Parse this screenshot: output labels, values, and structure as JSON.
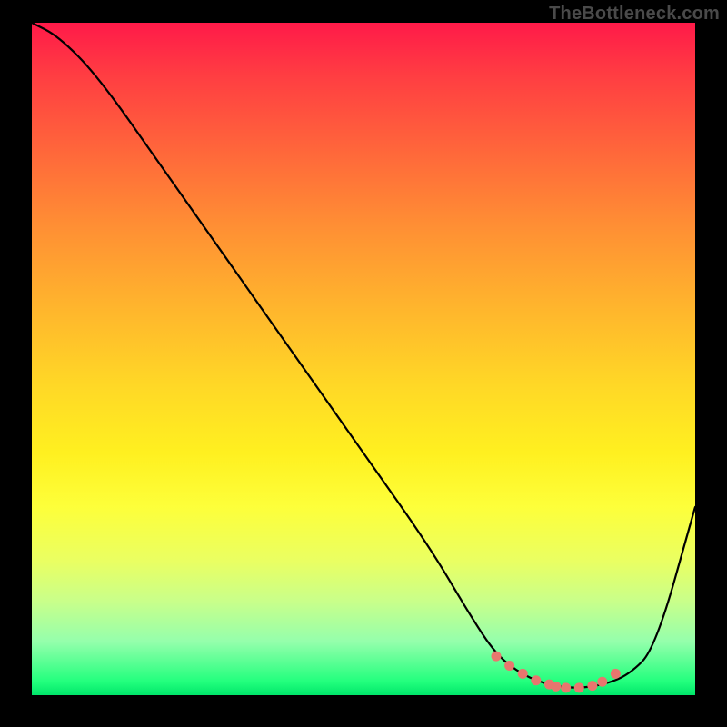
{
  "watermark": "TheBottleneck.com",
  "chart_data": {
    "type": "line",
    "title": "",
    "xlabel": "",
    "ylabel": "",
    "xlim": [
      0,
      100
    ],
    "ylim": [
      0,
      100
    ],
    "grid": false,
    "legend": false,
    "background": "rainbow-vertical-gradient",
    "series": [
      {
        "name": "main-curve",
        "color": "#000000",
        "x": [
          0,
          4,
          10,
          20,
          30,
          40,
          50,
          60,
          66,
          70,
          74,
          78,
          82,
          86,
          90,
          94,
          100
        ],
        "y": [
          100,
          98,
          92,
          78,
          64,
          50,
          36,
          22,
          12,
          6,
          3,
          1.5,
          1,
          1.5,
          3,
          7,
          28
        ]
      },
      {
        "name": "dot-markers",
        "color": "#e8766e",
        "type": "scatter",
        "x": [
          70,
          72,
          74,
          76,
          78,
          79,
          80.5,
          82.5,
          84.5,
          86,
          88
        ],
        "y": [
          5.8,
          4.4,
          3.2,
          2.2,
          1.6,
          1.3,
          1.1,
          1.1,
          1.4,
          2,
          3.2
        ]
      }
    ]
  }
}
